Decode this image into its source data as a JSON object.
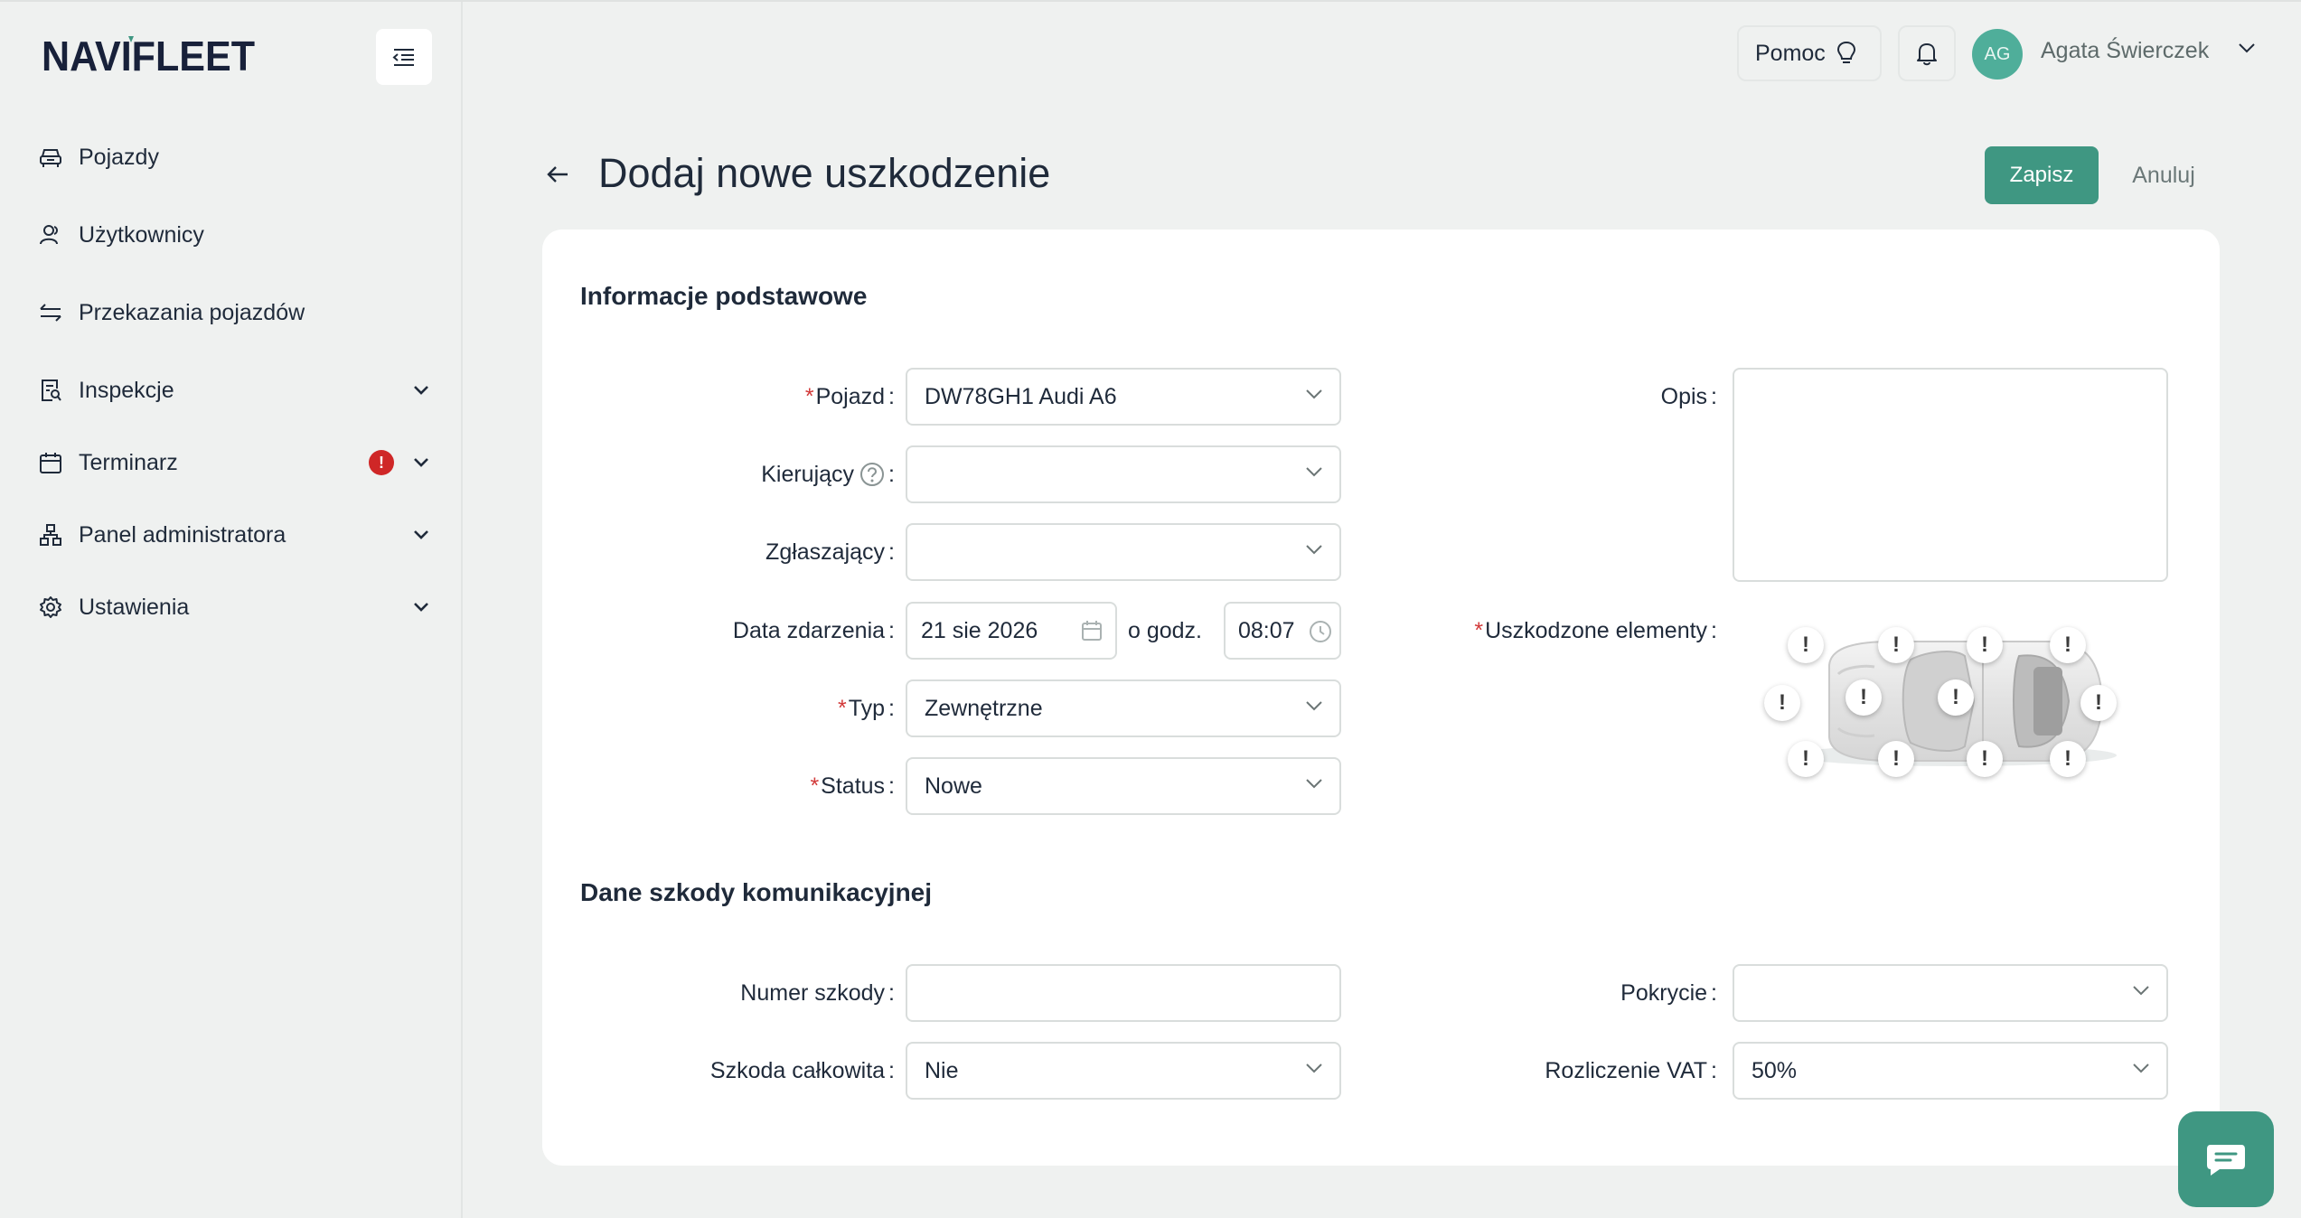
{
  "app": {
    "brand": "NAVIFLEET",
    "accent_color": "#3f9782",
    "danger_color": "#cf2727"
  },
  "sidebar": {
    "items": [
      {
        "label": "Pojazdy",
        "icon": "car-icon"
      },
      {
        "label": "Użytkownicy",
        "icon": "users-icon"
      },
      {
        "label": "Przekazania pojazdów",
        "icon": "transfer-icon"
      },
      {
        "label": "Inspekcje",
        "icon": "inspection-icon"
      },
      {
        "label": "Terminarz",
        "icon": "calendar-icon",
        "badge": "!"
      },
      {
        "label": "Panel administratora",
        "icon": "hierarchy-icon"
      },
      {
        "label": "Ustawienia",
        "icon": "gear-icon"
      }
    ]
  },
  "topbar": {
    "help_label": "Pomoc",
    "avatar_initials": "AG",
    "user_name": "Agata Świerczek"
  },
  "header": {
    "title": "Dodaj nowe uszkodzenie",
    "save_label": "Zapisz",
    "cancel_label": "Anuluj"
  },
  "basic": {
    "section_title": "Informacje podstawowe",
    "vehicle": {
      "label": "Pojazd",
      "value": "DW78GH1 Audi A6"
    },
    "driver": {
      "label": "Kierujący",
      "value": ""
    },
    "reporter": {
      "label": "Zgłaszający",
      "value": ""
    },
    "event_date": {
      "label": "Data zdarzenia",
      "date": "21 sie 2026",
      "at_label": "o godz.",
      "time": "08:07"
    },
    "type": {
      "label": "Typ",
      "value": "Zewnętrzne"
    },
    "status": {
      "label": "Status",
      "value": "Nowe"
    },
    "description": {
      "label": "Opis",
      "value": ""
    },
    "damaged": {
      "label": "Uszkodzone elementy",
      "marker": "!"
    }
  },
  "claim": {
    "section_title": "Dane szkody komunikacyjnej",
    "claim_number": {
      "label": "Numer szkody",
      "value": ""
    },
    "coverage": {
      "label": "Pokrycie",
      "value": ""
    },
    "total_loss": {
      "label": "Szkoda całkowita",
      "value": "Nie"
    },
    "vat": {
      "label": "Rozliczenie VAT",
      "value": "50%"
    }
  }
}
